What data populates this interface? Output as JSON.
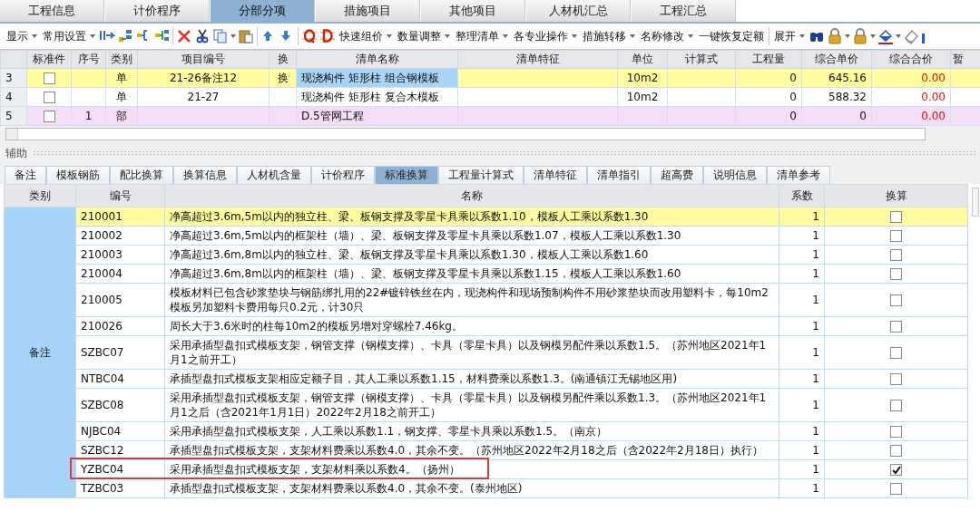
{
  "main_tabs": [
    {
      "label": "工程信息",
      "selected": false
    },
    {
      "label": "计价程序",
      "selected": false
    },
    {
      "label": "分部分项",
      "selected": true
    },
    {
      "label": "措施项目",
      "selected": false
    },
    {
      "label": "其他项目",
      "selected": false
    },
    {
      "label": "人材机汇总",
      "selected": false
    },
    {
      "label": "工程汇总",
      "selected": false
    }
  ],
  "toolbar": {
    "left_menus": [
      {
        "label": "显示",
        "dropdown": true
      },
      {
        "label": "常用设置",
        "dropdown": true
      }
    ],
    "right_menus": [
      {
        "label": "快速组价",
        "dropdown": true
      },
      {
        "label": "数量调整",
        "dropdown": true
      },
      {
        "label": "整理清单",
        "dropdown": true
      },
      {
        "label": "各专业操作",
        "dropdown": true
      },
      {
        "label": "措施转移",
        "dropdown": true
      },
      {
        "label": "名称修改",
        "dropdown": true
      },
      {
        "label": "一键恢复定额",
        "dropdown": false
      }
    ],
    "expand_menu": {
      "label": "展开",
      "dropdown": true
    }
  },
  "item_grid": {
    "columns": [
      "标准件",
      "序号",
      "类别",
      "项目编号",
      "换",
      "清单名称",
      "清单特征",
      "单位",
      "计算式",
      "工程量",
      "综合单价",
      "综合合价",
      "暂"
    ],
    "rows": [
      {
        "kind": "current",
        "row_number": "3",
        "standard": false,
        "type": "单",
        "code": "21-26备注12",
        "conversion": "换",
        "name": "现浇构件 矩形柱 组合钢模板",
        "name_selected": true,
        "unit": "10m2",
        "quantity": "0",
        "unit_price": "645.16",
        "total": "0.00"
      },
      {
        "kind": "item",
        "row_number": "4",
        "standard": false,
        "type": "单",
        "code": "21-27",
        "name": "现浇构件 矩形柱 复合木模板",
        "name_selected": false,
        "unit": "10m2",
        "quantity": "0",
        "unit_price": "588.32",
        "total": "0.00"
      },
      {
        "kind": "section",
        "row_number": "5",
        "standard": false,
        "seq": "1",
        "type": "部",
        "name": "D.5管网工程",
        "name_selected": false,
        "quantity": "0",
        "unit_price": "0",
        "total": "0.00"
      }
    ]
  },
  "aux_title": "辅助",
  "aux_tabs": [
    {
      "label": "备注",
      "selected": false
    },
    {
      "label": "模板钢筋",
      "selected": false
    },
    {
      "label": "配比换算",
      "selected": false
    },
    {
      "label": "换算信息",
      "selected": false
    },
    {
      "label": "人材机含量",
      "selected": false
    },
    {
      "label": "计价程序",
      "selected": false
    },
    {
      "label": "标准换算",
      "selected": true
    },
    {
      "label": "工程量计算式",
      "selected": false
    },
    {
      "label": "清单特征",
      "selected": false
    },
    {
      "label": "清单指引",
      "selected": false
    },
    {
      "label": "超高费",
      "selected": false
    },
    {
      "label": "说明信息",
      "selected": false
    },
    {
      "label": "清单参考",
      "selected": false
    }
  ],
  "conversion_table": {
    "columns": [
      "类别",
      "编号",
      "名称",
      "系数",
      "换算"
    ],
    "category": "备注",
    "rows": [
      {
        "code": "210001",
        "name": "净高超过3.6m,5m以内的独立柱、梁、板钢支撑及零星卡具乘以系数1.10，模板人工乘以系数1.30",
        "coefficient": "1",
        "checked": false,
        "current": true,
        "highlighted": false
      },
      {
        "code": "210002",
        "name": "净高超过3.6m,5m以内的框架柱（墙）、梁、板钢支撑及零星卡具乘以系数1.07，模板人工乘以系数1.30",
        "coefficient": "1",
        "checked": false,
        "current": false,
        "highlighted": false
      },
      {
        "code": "210003",
        "name": "净高超过3.6m,8m以内的独立柱、梁、板钢支撑及零星卡具乘以系数1.30，模板人工乘以系数1.60",
        "coefficient": "1",
        "checked": false,
        "current": false,
        "highlighted": false
      },
      {
        "code": "210004",
        "name": "净高超过3.6m,8m以内的框架柱（墙）、梁、板钢支撑及零星卡具乘以系数1.15，模板人工乘以系数1.60",
        "coefficient": "1",
        "checked": false,
        "current": false,
        "highlighted": false
      },
      {
        "code": "210005",
        "name": "模板材料已包含砂浆垫块与钢筋绑扎用的22#镀锌铁丝在内，现浇构件和现场预制构件不用砂浆垫块而改用塑料卡，每10m2模板另加塑料卡费用每只0.2元，计30只",
        "coefficient": "1",
        "checked": false,
        "current": false,
        "highlighted": false
      },
      {
        "code": "210026",
        "name": "周长大于3.6米时的柱每10m2的模板另增对穿螺栓7.46kg。",
        "coefficient": "1",
        "checked": false,
        "current": false,
        "highlighted": false
      },
      {
        "code": "SZBC07",
        "name": "采用承插型盘扣式模板支架，钢管支撑（钢模支撑）、卡具（零星卡具）以及钢模另配件乘以系数1.5。（苏州地区2021年1月1之前开工）",
        "coefficient": "1",
        "checked": false,
        "current": false,
        "highlighted": false
      },
      {
        "code": "NTBC04",
        "name": "承插型盘扣式模板支架相应定额子目，其人工乘以系数1.15，材料费乘以系数1.3。(南通镇江无锡地区用)",
        "coefficient": "1",
        "checked": false,
        "current": false,
        "highlighted": false
      },
      {
        "code": "SZBC08",
        "name": "采用承插型盘扣式模板支架，钢管支撑（钢模支撑）、卡具（零星卡具）以及钢模另配件乘以系数1.3。（苏州地区2021年1月1之后（含2021年1月1日）2022年2月18之前开工）",
        "coefficient": "1",
        "checked": false,
        "current": false,
        "highlighted": false
      },
      {
        "code": "NJBC04",
        "name": "采用承插型盘扣式模板支架，人工乘以系数1.1，钢支撑、零星卡具乘以系数1.5。（南京）",
        "coefficient": "1",
        "checked": false,
        "current": false,
        "highlighted": false
      },
      {
        "code": "SZBC12",
        "name": "承插型盘扣式模板支架，支架材料费乘以系数4.0，其余不变。（苏州地区2022年2月18之后（含2022年2月18日）执行）",
        "coefficient": "1",
        "checked": false,
        "current": false,
        "highlighted": false
      },
      {
        "code": "YZBC04",
        "name": "采用承插型盘扣式模板支架，支架材料乘以系数4。（扬州）",
        "coefficient": "1",
        "checked": true,
        "current": false,
        "highlighted": true
      },
      {
        "code": "TZBC03",
        "name": "承插型盘扣式模板支架，支架材料费乘以系数4.0，其余不变。(泰州地区)",
        "coefficient": "1",
        "checked": false,
        "current": false,
        "highlighted": false
      }
    ]
  }
}
